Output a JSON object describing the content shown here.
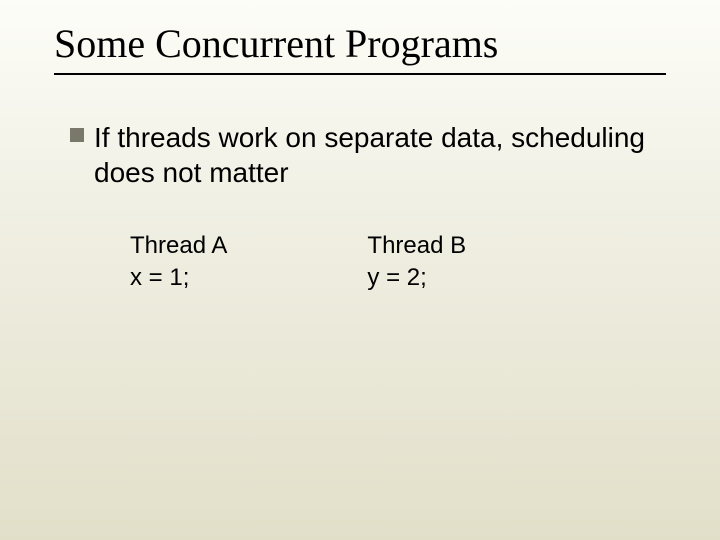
{
  "slide": {
    "title": "Some Concurrent Programs",
    "bullet": "If threads work on separate data, scheduling does not matter",
    "threadA": {
      "label": "Thread A",
      "code": "x = 1;"
    },
    "threadB": {
      "label": "Thread B",
      "code": "y = 2;"
    }
  }
}
